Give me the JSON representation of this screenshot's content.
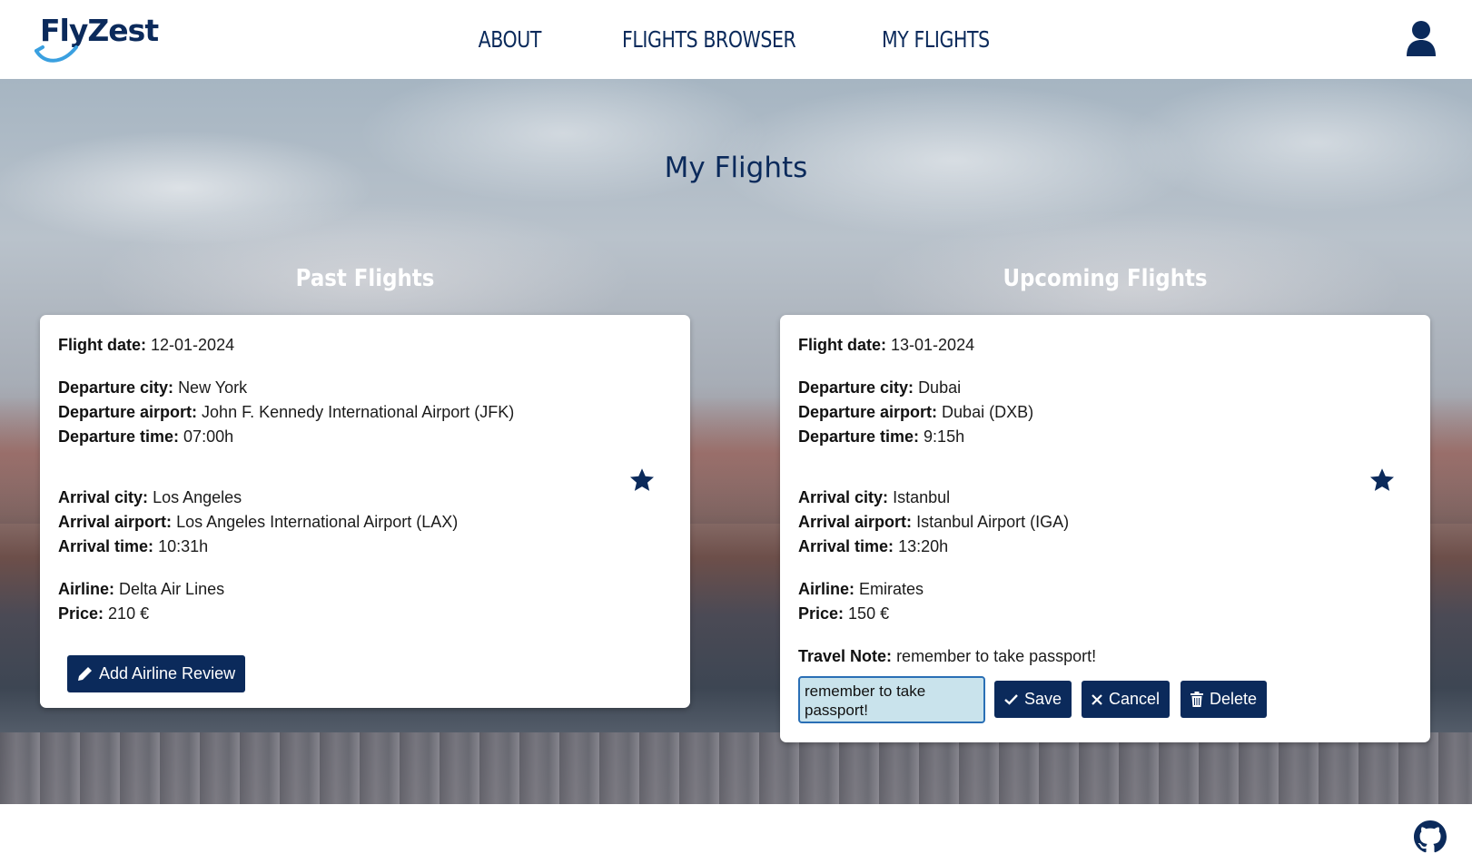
{
  "header": {
    "logo": {
      "part1": "Fly",
      "part2": "Zest"
    },
    "nav": [
      {
        "label": "ABOUT"
      },
      {
        "label": "FLIGHTS BROWSER"
      },
      {
        "label": "MY FLIGHTS"
      }
    ],
    "user_icon": "user-icon"
  },
  "page": {
    "title": "My Flights"
  },
  "past": {
    "heading": "Past Flights",
    "flight": {
      "date_label": "Flight date:",
      "date": "12-01-2024",
      "dep_city_label": "Departure city:",
      "dep_city": "New York",
      "dep_airport_label": "Departure airport:",
      "dep_airport": "John F. Kennedy International Airport (JFK)",
      "dep_time_label": "Departure time:",
      "dep_time": "07:00h",
      "arr_city_label": "Arrival city:",
      "arr_city": "Los Angeles",
      "arr_airport_label": "Arrival airport:",
      "arr_airport": "Los Angeles International Airport (LAX)",
      "arr_time_label": "Arrival time:",
      "arr_time": "10:31h",
      "airline_label": "Airline:",
      "airline": "Delta Air Lines",
      "price_label": "Price:",
      "price": "210 €",
      "review_button": "Add Airline Review"
    }
  },
  "upcoming": {
    "heading": "Upcoming Flights",
    "flight": {
      "date_label": "Flight date:",
      "date": "13-01-2024",
      "dep_city_label": "Departure city:",
      "dep_city": "Dubai",
      "dep_airport_label": "Departure airport:",
      "dep_airport": "Dubai (DXB)",
      "dep_time_label": "Departure time:",
      "dep_time": "9:15h",
      "arr_city_label": "Arrival city:",
      "arr_city": "Istanbul",
      "arr_airport_label": "Arrival airport:",
      "arr_airport": "Istanbul Airport (IGA)",
      "arr_time_label": "Arrival time:",
      "arr_time": "13:20h",
      "airline_label": "Airline:",
      "airline": "Emirates",
      "price_label": "Price:",
      "price": "150 €",
      "note_label": "Travel Note:",
      "note": "remember to take passport!",
      "note_input_value": "remember to take passport!",
      "save_button": "Save",
      "cancel_button": "Cancel",
      "delete_button": "Delete"
    }
  },
  "colors": {
    "brand": "#0b2a5b",
    "note_input_bg": "#c9e3ec",
    "logo_swoosh": "#3aa0e0"
  },
  "footer": {
    "icon": "github-icon"
  }
}
